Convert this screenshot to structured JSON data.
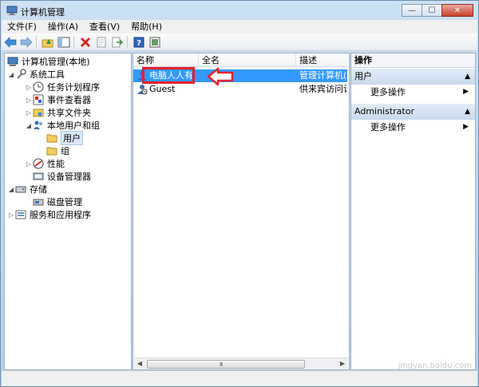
{
  "window": {
    "title": "计算机管理",
    "minimize": "—",
    "maximize": "☐",
    "close": "✕"
  },
  "menu": [
    "文件(F)",
    "操作(A)",
    "查看(V)",
    "帮助(H)"
  ],
  "tree": {
    "root": "计算机管理(本地)",
    "system_tools": "系统工具",
    "task_scheduler": "任务计划程序",
    "event_viewer": "事件查看器",
    "shared_folders": "共享文件夹",
    "local_users": "本地用户和组",
    "users": "用户",
    "groups": "组",
    "performance": "性能",
    "device_manager": "设备管理器",
    "storage": "存储",
    "disk_management": "磁盘管理",
    "services_apps": "服务和应用程序"
  },
  "list": {
    "columns": [
      "名称",
      "全名",
      "描述"
    ],
    "rows": [
      {
        "name": "电脑人人有",
        "fullname": "",
        "desc": "管理计算机(域"
      },
      {
        "name": "Guest",
        "fullname": "",
        "desc": "供来宾访问计"
      }
    ],
    "scroll_grip": "III"
  },
  "actions": {
    "title": "操作",
    "sections": [
      {
        "label": "用户",
        "item": "更多操作"
      },
      {
        "label": "Administrator",
        "item": "更多操作"
      }
    ]
  },
  "watermark": "jingyan.baidu.com",
  "colors": {
    "selection": "#3399ff",
    "highlight_box": "#e8202a"
  }
}
